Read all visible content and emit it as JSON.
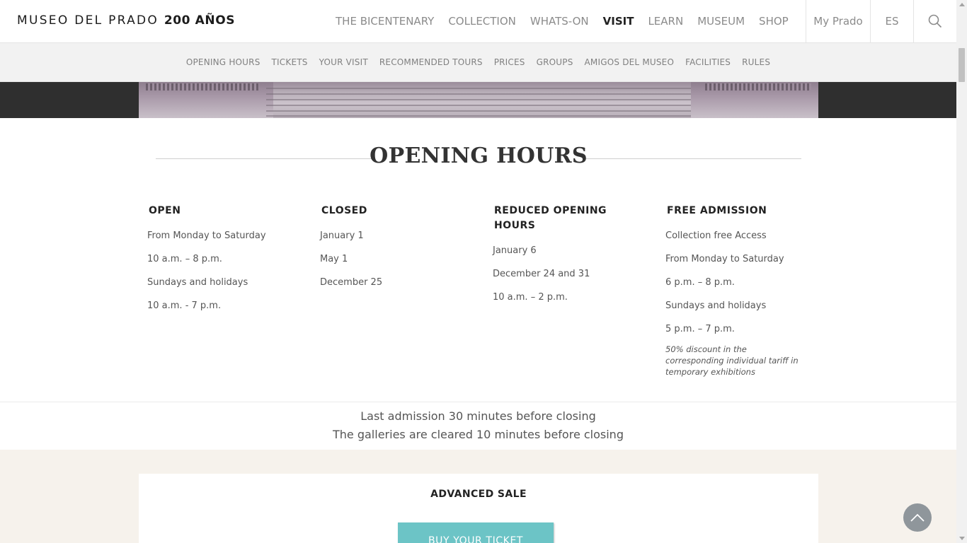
{
  "header": {
    "logo_text": "MUSEO DEL PRADO",
    "logo_bold": "200 AÑOS",
    "nav": [
      {
        "label": "THE BICENTENARY"
      },
      {
        "label": "COLLECTION"
      },
      {
        "label": "WHATS-ON"
      },
      {
        "label": "VISIT",
        "active": true
      },
      {
        "label": "LEARN"
      },
      {
        "label": "MUSEUM"
      },
      {
        "label": "SHOP"
      }
    ],
    "my_prado": "My Prado",
    "language": "ES",
    "search_icon": "search-icon"
  },
  "subnav": [
    {
      "label": "OPENING HOURS"
    },
    {
      "label": "TICKETS"
    },
    {
      "label": "YOUR VISIT"
    },
    {
      "label": "RECOMMENDED TOURS"
    },
    {
      "label": "PRICES"
    },
    {
      "label": "GROUPS"
    },
    {
      "label": "AMIGOS DEL MUSEO"
    },
    {
      "label": "FACILITIES"
    },
    {
      "label": "RULES"
    }
  ],
  "section_title": "OPENING HOURS",
  "columns": {
    "open": {
      "title": "OPEN",
      "lines": [
        "From Monday to Saturday",
        "10 a.m. – 8 p.m.",
        "Sundays and holidays",
        "10 a.m. - 7 p.m."
      ]
    },
    "closed": {
      "title": "CLOSED",
      "lines": [
        "January 1",
        "May 1",
        "December 25"
      ]
    },
    "reduced": {
      "title": "REDUCED OPENING HOURS",
      "lines": [
        "January 6",
        "December 24 and 31",
        "10 a.m. – 2 p.m."
      ]
    },
    "free": {
      "title": "FREE ADMISSION",
      "lines": [
        "Collection free Access",
        "From Monday to Saturday",
        "6 p.m. – 8 p.m.",
        "Sundays and holidays",
        "5 p.m. – 7 p.m."
      ],
      "note": "50% discount in the corresponding individual tariff in temporary exhibitions"
    }
  },
  "closing_notes": {
    "last_admission": "Last admission 30 minutes before closing",
    "cleared": "The galleries are cleared 10 minutes before closing"
  },
  "sale": {
    "title": "ADVANCED SALE",
    "button": "BUY YOUR TICKET"
  },
  "colors": {
    "accent_button": "#6cc4c6",
    "sale_background": "#f6f2ec",
    "hero_band": "#2f2f2f"
  }
}
